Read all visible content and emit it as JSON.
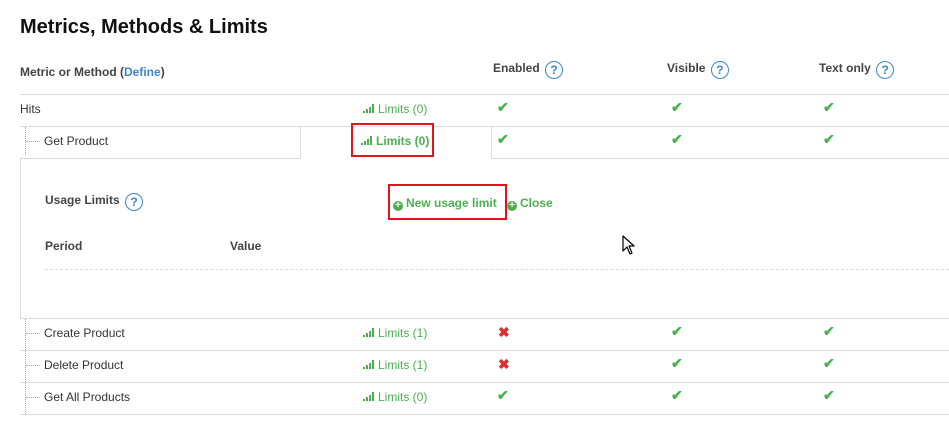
{
  "page": {
    "title": "Metrics, Methods & Limits"
  },
  "header": {
    "metric_label": "Metric or Method (",
    "define_link": "Define",
    "metric_label_end": ")",
    "enabled": "Enabled",
    "visible": "Visible",
    "text_only": "Text only",
    "help": "?"
  },
  "rows": {
    "hits": {
      "name": "Hits",
      "limits": "Limits (0)",
      "enabled": "✔",
      "visible": "✔",
      "text_only": "✔"
    },
    "get_product": {
      "name": "Get Product",
      "limits": "Limits (0)",
      "enabled": "✔",
      "visible": "✔",
      "text_only": "✔"
    },
    "create_product": {
      "name": "Create Product",
      "limits": "Limits (1)",
      "enabled": "✖",
      "visible": "✔",
      "text_only": "✔"
    },
    "delete_product": {
      "name": "Delete Product",
      "limits": "Limits (1)",
      "enabled": "✖",
      "visible": "✔",
      "text_only": "✔"
    },
    "get_all_products": {
      "name": "Get All Products",
      "limits": "Limits (0)",
      "enabled": "✔",
      "visible": "✔",
      "text_only": "✔"
    }
  },
  "usage_panel": {
    "title": "Usage Limits",
    "new_limit": "New usage limit",
    "close": "Close",
    "period_header": "Period",
    "value_header": "Value"
  },
  "colors": {
    "accent_green": "#4caf50",
    "link_blue": "#3a87c8",
    "highlight_red": "#e0151b",
    "disabled_red": "#d9302c"
  },
  "icons": {
    "enabled": "check-icon",
    "disabled": "cross-icon",
    "help": "help-icon",
    "limits": "bar-chart-icon",
    "add": "plus-circle-icon"
  }
}
